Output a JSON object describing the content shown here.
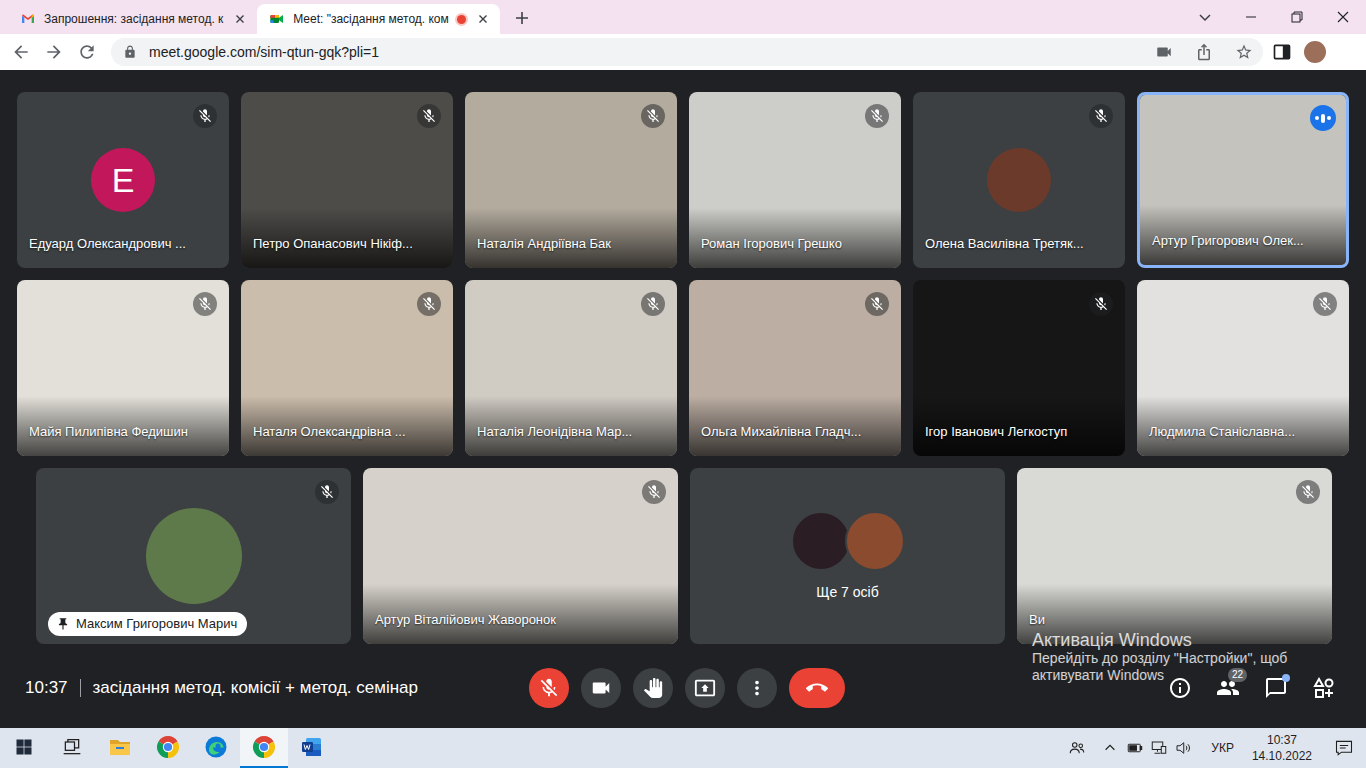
{
  "browser": {
    "tabs": [
      {
        "label": "Запрошення: засідання метод. к",
        "kind": "gmail",
        "selected": false,
        "recording": false
      },
      {
        "label": "Meet: \"засідання метод. ком",
        "kind": "meet",
        "selected": true,
        "recording": true
      }
    ],
    "address": "meet.google.com/sim-qtun-gqk?pli=1",
    "profile_color": "#9b6f5a"
  },
  "tiles": [
    {
      "name": "Едуард Олександрович ...",
      "kind": "letter",
      "letter": "Е",
      "avatar_color": "#c2185b",
      "color": "#3c4043",
      "muted": true,
      "speaking": false,
      "pill": false
    },
    {
      "name": "Петро Опанасович Нікіф...",
      "kind": "video",
      "color": "#4e4c49",
      "muted": true,
      "speaking": false,
      "pill": false
    },
    {
      "name": "Наталія Андріївна Бак",
      "kind": "video",
      "color": "#b3ab9e",
      "muted": true,
      "speaking": false,
      "pill": false
    },
    {
      "name": "Роман Ігорович Грешко",
      "kind": "video",
      "color": "#cdcdc9",
      "muted": true,
      "speaking": false,
      "pill": false
    },
    {
      "name": "Олена Василівна Третяк...",
      "kind": "photo",
      "avatar_color": "#6b3a2a",
      "color": "#3c4043",
      "muted": true,
      "speaking": false,
      "pill": false
    },
    {
      "name": "Артур Григорович Олек...",
      "kind": "video",
      "color": "#c4c3bd",
      "muted": false,
      "speaking": true,
      "pill": false
    },
    {
      "name": "Майя Пилипівна Федишин",
      "kind": "video",
      "color": "#e3e0d9",
      "muted": true,
      "speaking": false,
      "pill": false
    },
    {
      "name": "Наталя Олександрівна ...",
      "kind": "video",
      "color": "#cbbdac",
      "muted": true,
      "speaking": false,
      "pill": false
    },
    {
      "name": "Наталія Леонідівна Мар...",
      "kind": "video",
      "color": "#d0cbc3",
      "muted": true,
      "speaking": false,
      "pill": false
    },
    {
      "name": "Ольга Михайлівна Гладч...",
      "kind": "video",
      "color": "#bcaea3",
      "muted": true,
      "speaking": false,
      "pill": false
    },
    {
      "name": "Ігор Іванович Легкоступ",
      "kind": "video",
      "color": "#161616",
      "muted": true,
      "speaking": false,
      "pill": false
    },
    {
      "name": "Людмила Станіславна...",
      "kind": "video",
      "color": "#e2e1df",
      "muted": true,
      "speaking": false,
      "pill": false
    },
    {
      "name": "Максим Григорович Марич",
      "kind": "photo",
      "avatar_color": "#5f7a4a",
      "color": "#3c4043",
      "muted": true,
      "speaking": false,
      "pill": true
    },
    {
      "name": "Артур Віталійович Жаворонок",
      "kind": "video",
      "color": "#d6d2cb",
      "muted": true,
      "speaking": false,
      "pill": false
    },
    {
      "name": "Ще 7 осіб",
      "kind": "others",
      "avatars": [
        {
          "color": "#2b1d24"
        },
        {
          "color": "#8a4b2e"
        }
      ],
      "color": "#3c4043",
      "muted": false,
      "speaking": false,
      "pill": false
    },
    {
      "name": "Ви",
      "kind": "video",
      "color": "#d9d9d5",
      "muted": true,
      "speaking": false,
      "pill": false
    }
  ],
  "meeting": {
    "time": "10:37",
    "title": "засідання метод. комісії + метод. семінар"
  },
  "controls": [
    {
      "kind": "mic",
      "red": true
    },
    {
      "kind": "camera",
      "red": false
    },
    {
      "kind": "hand",
      "red": false
    },
    {
      "kind": "present",
      "red": false
    },
    {
      "kind": "more",
      "red": false
    },
    {
      "kind": "end-call",
      "red": true
    }
  ],
  "tools": [
    {
      "kind": "info",
      "dot": false
    },
    {
      "kind": "people",
      "dot": false,
      "badge": "22"
    },
    {
      "kind": "chat",
      "dot": true
    },
    {
      "kind": "activities",
      "dot": false
    }
  ],
  "watermark": {
    "title": "Активація Windows",
    "lines": [
      "Перейдіть до розділу \"Настройки\", щоб",
      "активувати Windows"
    ]
  },
  "taskbar": {
    "apps": [
      {
        "kind": "start",
        "active": false
      },
      {
        "kind": "task-view",
        "active": false
      },
      {
        "kind": "explorer",
        "active": false
      },
      {
        "kind": "chrome",
        "active": false
      },
      {
        "kind": "edge",
        "active": false
      },
      {
        "kind": "chrome",
        "active": true
      },
      {
        "kind": "word",
        "active": false
      }
    ],
    "language": "УКР",
    "time": "10:37",
    "date": "14.10.2022"
  }
}
